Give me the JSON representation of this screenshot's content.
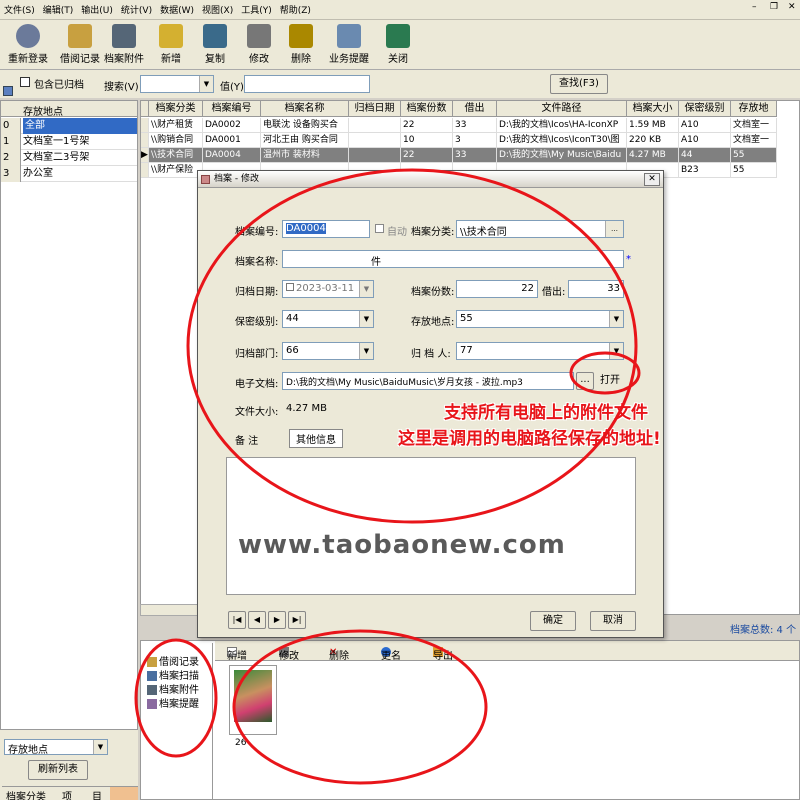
{
  "menu": [
    "文件(S)",
    "编辑(T)",
    "输出(U)",
    "统计(V)",
    "数据(W)",
    "视图(X)",
    "工具(Y)",
    "帮助(Z)"
  ],
  "toolbar": {
    "buttons": [
      {
        "label": "重新登录",
        "icon": "relogin-icon",
        "color": "#6b7a9a"
      },
      {
        "label": "借阅记录",
        "icon": "borrow-record-icon",
        "color": "#c8a040"
      },
      {
        "label": "档案附件",
        "icon": "attachment-icon",
        "color": "#556677"
      },
      {
        "label": "新增",
        "icon": "add-icon",
        "color": "#d4b030"
      },
      {
        "label": "复制",
        "icon": "copy-icon",
        "color": "#3a6a8a"
      },
      {
        "label": "修改",
        "icon": "edit-icon",
        "color": "#777"
      },
      {
        "label": "删除",
        "icon": "delete-icon",
        "color": "#aa8800"
      },
      {
        "label": "业务提醒",
        "icon": "calendar-icon",
        "color": "#6a8ab0"
      },
      {
        "label": "关闭",
        "icon": "close-door-icon",
        "color": "#2a7a50"
      }
    ]
  },
  "search": {
    "include_archived": "包含已归档",
    "search_label": "搜索(V)",
    "value_label": "值(Y)",
    "find_button": "查找(F3)"
  },
  "left": {
    "header": "存放地点",
    "rows": [
      {
        "n": "0",
        "t": "全部"
      },
      {
        "n": "1",
        "t": "文档室一1号架"
      },
      {
        "n": "2",
        "t": "文档室二3号架"
      },
      {
        "n": "3",
        "t": "办公室"
      }
    ]
  },
  "grid": {
    "headers": [
      "档案分类",
      "档案编号",
      "档案名称",
      "归档日期",
      "档案份数",
      "借出",
      "文件路径",
      "档案大小",
      "保密级别",
      "存放地"
    ],
    "rows": [
      [
        "\\\\财产租赁",
        "DA0002",
        "电联沈     设备购买合",
        "",
        "22",
        "33",
        "D:\\我的文档\\Icos\\HA-IconXP",
        "1.59 MB",
        "A10",
        "文档室一"
      ],
      [
        "\\\\购销合同",
        "DA0001",
        "河北王由     购买合同",
        "",
        "10",
        "3",
        "D:\\我的文档\\Icos\\IconT30\\图",
        "220 KB",
        "A10",
        "文档室一"
      ],
      [
        "\\\\技术合同",
        "DA0004",
        "温州市     装材料",
        "",
        "22",
        "33",
        "D:\\我的文档\\My Music\\Baidu",
        "4.27 MB",
        "44",
        "55"
      ],
      [
        "\\\\财产保险",
        "",
        "",
        "",
        "",
        "",
        "",
        "",
        "B23",
        "55"
      ]
    ],
    "total": "档案总数: 4 个"
  },
  "dialog": {
    "title": "档案 - 修改",
    "archive_no_label": "档案编号:",
    "archive_no": "DA0004",
    "auto_label": "自动",
    "category_label": "档案分类:",
    "category": "\\\\技术合同",
    "name_label": "档案名称:",
    "name_suffix": "件",
    "date_label": "归档日期:",
    "date": "2023-03-11",
    "copies_label": "档案份数:",
    "copies": "22",
    "lent_label": "借出:",
    "lent": "33",
    "secret_label": "保密级别:",
    "secret": "44",
    "location_label": "存放地点:",
    "location": "55",
    "dept_label": "归档部门:",
    "dept": "66",
    "archiver_label": "归 档 人:",
    "archiver": "77",
    "efile_label": "电子文档:",
    "efile": "D:\\我的文档\\My Music\\BaiduMusic\\岁月女孩 - 波拉.mp3",
    "browse": "...",
    "open": "打开",
    "size_label": "文件大小:",
    "size": "4.27 MB",
    "tab_note": "备    注",
    "tab_other": "其他信息",
    "ok": "确定",
    "cancel": "取消",
    "nav": [
      "|◀",
      "◀",
      "▶",
      "▶|"
    ]
  },
  "annotation": {
    "line1": "支持所有电脑上的附件文件",
    "line2": "这里是调用的电脑路径保存的地址!",
    "color": "#e8151a"
  },
  "watermark": "www.taobaonew.com",
  "bottom": {
    "side_items": [
      "借阅记录",
      "档案扫描",
      "档案附件",
      "档案提醒"
    ],
    "sub_toolbar": [
      "新增",
      "修改",
      "删除",
      "更名",
      "导出"
    ],
    "thumb_caption": "26"
  },
  "leftbottom": {
    "select": "存放地点",
    "refresh": "刷新列表",
    "tabs": [
      "档案分类",
      "项",
      "目"
    ]
  }
}
